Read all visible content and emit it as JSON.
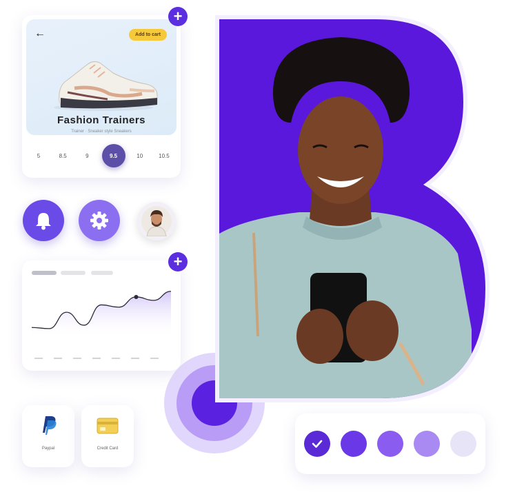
{
  "product": {
    "back_icon": "arrow-left-icon",
    "cart_badge": "Add to cart",
    "title": "Fashion Trainers",
    "subtitle": "Trainer · Sneaker style Sneakers",
    "sizes": [
      "5",
      "8.5",
      "9",
      "9.5",
      "10",
      "10.5"
    ],
    "selected_size": "9.5",
    "add_icon": "plus-icon"
  },
  "actions": {
    "bell_icon": "bell-icon",
    "gear_icon": "gear-icon",
    "avatar_icon": "avatar"
  },
  "chart_data": {
    "type": "area",
    "title": "",
    "xlabel": "",
    "ylabel": "",
    "x": [
      0,
      1,
      2,
      3,
      4,
      5,
      6,
      7,
      8
    ],
    "values": [
      18,
      16,
      45,
      22,
      58,
      54,
      72,
      66,
      82
    ],
    "highlight_index": 6,
    "ylim": [
      0,
      100
    ],
    "grid": false
  },
  "payments": {
    "paypal_label": "Paypal",
    "card_label": "Credit Card"
  },
  "swatches": {
    "colors": [
      "#5a2ad6",
      "#6a38e6",
      "#8a5cf0",
      "#a98af3",
      "#e8e4f8"
    ],
    "selected_index": 0,
    "check_icon": "check-icon"
  },
  "brand": {
    "accent": "#5b2ee0",
    "letter_icon": "brand-letter-b"
  }
}
